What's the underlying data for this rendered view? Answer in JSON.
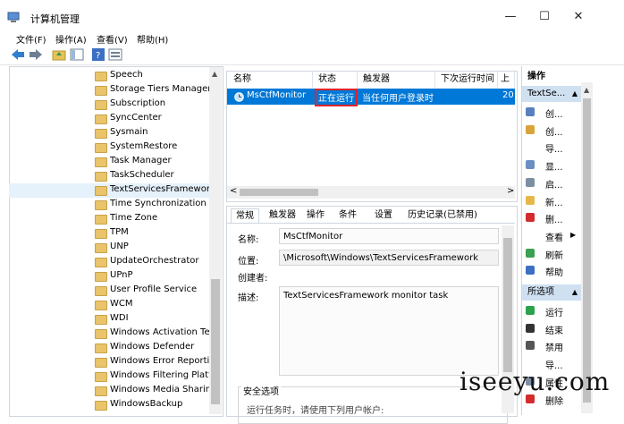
{
  "window": {
    "title": "计算机管理",
    "controls": {
      "minimize": "—",
      "maximize": "☐",
      "close": "✕"
    }
  },
  "menu": [
    "文件(F)",
    "操作(A)",
    "查看(V)",
    "帮助(H)"
  ],
  "toolbar": {
    "icons": [
      "back-icon",
      "forward-icon",
      "up-folder-icon",
      "show-hide-tree-icon",
      "help-icon",
      "properties-icon"
    ]
  },
  "tree": {
    "scroll_up": "▲",
    "selected": "TextServicesFramework",
    "items": [
      "Speech",
      "Storage Tiers Managen",
      "Subscription",
      "SyncCenter",
      "Sysmain",
      "SystemRestore",
      "Task Manager",
      "TaskScheduler",
      "TextServicesFramework",
      "Time Synchronization",
      "Time Zone",
      "TPM",
      "UNP",
      "UpdateOrchestrator",
      "UPnP",
      "User Profile Service",
      "WCM",
      "WDI",
      "Windows Activation Tec",
      "Windows Defender",
      "Windows Error Reportir",
      "Windows Filtering Platfc",
      "Windows Media Sharin",
      "WindowsBackup"
    ]
  },
  "task_list": {
    "columns": [
      "名称",
      "状态",
      "触发器",
      "下次运行时间",
      "上次"
    ],
    "rows": [
      {
        "name": "MsCtfMonitor",
        "status": "正在运行",
        "trigger": "当任何用户登录时",
        "next_run": "",
        "last_run": "20"
      }
    ],
    "scroll_left": "<",
    "scroll_right": ">"
  },
  "details": {
    "tabs": [
      "常规",
      "触发器",
      "操作",
      "条件",
      "设置",
      "历史记录(已禁用)"
    ],
    "active_tab": "常规",
    "fields": {
      "name_label": "名称:",
      "name_value": "MsCtfMonitor",
      "location_label": "位置:",
      "location_value": "\\Microsoft\\Windows\\TextServicesFramework",
      "author_label": "创建者:",
      "author_value": "",
      "description_label": "描述:",
      "description_value": "TextServicesFramework monitor task"
    },
    "security": {
      "heading": "安全选项",
      "partial_text": "运行任务时，请使用下列用户帐户:"
    }
  },
  "actions": {
    "header": "操作",
    "section1_title": "TextSe...",
    "section1_items": [
      {
        "label": "创...",
        "icon": "create-basic-task-icon",
        "color": "#5a7fbd"
      },
      {
        "label": "创...",
        "icon": "create-task-icon",
        "color": "#d9a33a"
      },
      {
        "label": "导...",
        "icon": "",
        "color": ""
      },
      {
        "label": "显...",
        "icon": "display-running-tasks-icon",
        "color": "#6b8fc2"
      },
      {
        "label": "启...",
        "icon": "enable-history-icon",
        "color": "#7d8fa3"
      },
      {
        "label": "新...",
        "icon": "new-folder-icon",
        "color": "#e6b84c"
      },
      {
        "label": "删...",
        "icon": "delete-folder-icon",
        "color": "#d22c2c"
      },
      {
        "label": "查看",
        "icon": "",
        "color": ""
      },
      {
        "label": "刷新",
        "icon": "refresh-icon",
        "color": "#3aa150"
      },
      {
        "label": "帮助",
        "icon": "help-icon",
        "color": "#3b6fc2"
      }
    ],
    "section2_title": "所选项",
    "section2_items": [
      {
        "label": "运行",
        "icon": "run-icon",
        "color": "#2ca24a"
      },
      {
        "label": "结束",
        "icon": "end-icon",
        "color": "#333333"
      },
      {
        "label": "禁用",
        "icon": "disable-icon",
        "color": "#555555"
      },
      {
        "label": "导...",
        "icon": "",
        "color": ""
      },
      {
        "label": "属性",
        "icon": "properties-icon",
        "color": "#7d8fa3"
      },
      {
        "label": "删除",
        "icon": "delete-icon",
        "color": "#d22c2c"
      }
    ]
  },
  "watermark": "iseeyu.com"
}
